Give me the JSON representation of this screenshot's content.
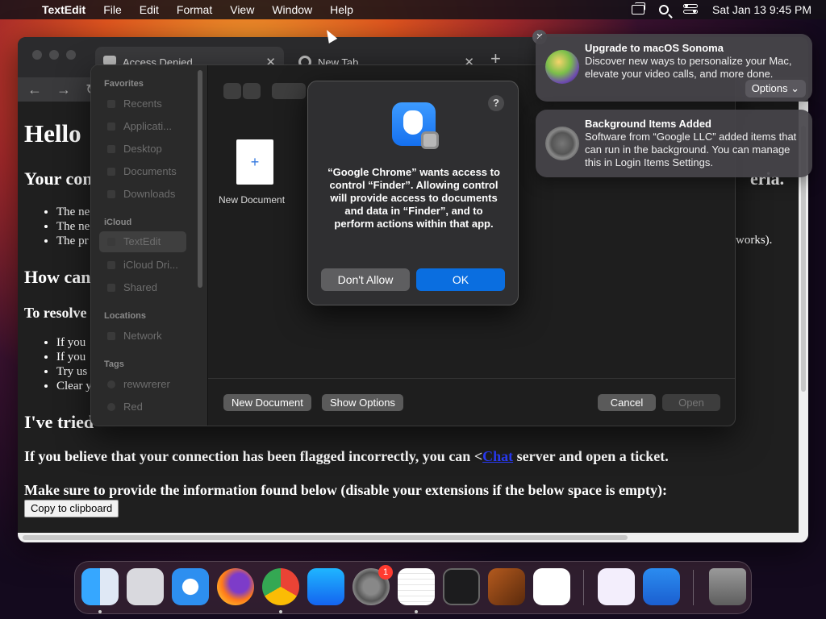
{
  "menubar": {
    "app": "TextEdit",
    "items": [
      "File",
      "Edit",
      "Format",
      "View",
      "Window",
      "Help"
    ],
    "clock": "Sat Jan 13  9:45 PM"
  },
  "browser": {
    "tabs": [
      {
        "label": "Access Denied",
        "close": "✕"
      },
      {
        "label": "New Tab",
        "close": "✕"
      }
    ],
    "newtab": "+",
    "page": {
      "h1": "Hello",
      "h2_a": "Your con",
      "h2_a_right": "eria.",
      "bullets_a": [
        "The ne",
        "The ne",
        "The pr"
      ],
      "bullet_right": "works).",
      "h2_b": "How can",
      "h3": "To resolve",
      "bullets_b": [
        "If you",
        "If you",
        "Try us",
        "Clear y"
      ],
      "h2_c": "I've tried",
      "flagged_prefix": "If you believe that your connection has been flagged incorrectly, you can <",
      "flagged_link": "Chat",
      "flagged_suffix": " server and open a ticket.",
      "provide": "Make sure to provide the information found below (disable your extensions if the below space is empty):",
      "copy_button": "Copy to clipboard"
    }
  },
  "openpanel": {
    "sidebar": {
      "favorites_header": "Favorites",
      "favorites": [
        "Recents",
        "Applicati...",
        "Desktop",
        "Documents",
        "Downloads"
      ],
      "icloud_header": "iCloud",
      "icloud": [
        "TextEdit",
        "iCloud Dri...",
        "Shared"
      ],
      "locations_header": "Locations",
      "locations": [
        "Network"
      ],
      "tags_header": "Tags",
      "tags": [
        "rewwrerer",
        "Red"
      ]
    },
    "new_document_tile": "New Document",
    "new_doc_plus": "+",
    "buttons": {
      "new_document": "New Document",
      "show_options": "Show Options",
      "cancel": "Cancel",
      "open": "Open"
    }
  },
  "alert": {
    "help": "?",
    "message": "“Google Chrome” wants access to control “Finder”. Allowing control will provide access to documents and data in “Finder”, and to perform actions within that app.",
    "deny": "Don't Allow",
    "ok": "OK"
  },
  "notifications": [
    {
      "title": "Upgrade to macOS Sonoma",
      "body": "Discover new ways to personalize your Mac, elevate your video calls, and more done.",
      "options": "Options ⌄"
    },
    {
      "title": "Background Items Added",
      "body": "Software from “Google LLC” added items that can run in the background. You can manage this in Login Items Settings."
    }
  ],
  "notif_close": "✕",
  "dock": {
    "settings_badge": "1",
    "apps": [
      "finder-icon",
      "launchpad-icon",
      "safari-icon",
      "firefox-icon",
      "chrome-icon",
      "app-store-icon",
      "system-settings-icon",
      "textedit-icon",
      "terminal-icon",
      "garageband-icon",
      "vscode-icon",
      "visual-studio-icon",
      "weather-icon",
      "trash-icon"
    ]
  },
  "colors": {
    "accent": "#0a6ee0",
    "link": "#2a3cff",
    "badge": "#ff3b30"
  }
}
